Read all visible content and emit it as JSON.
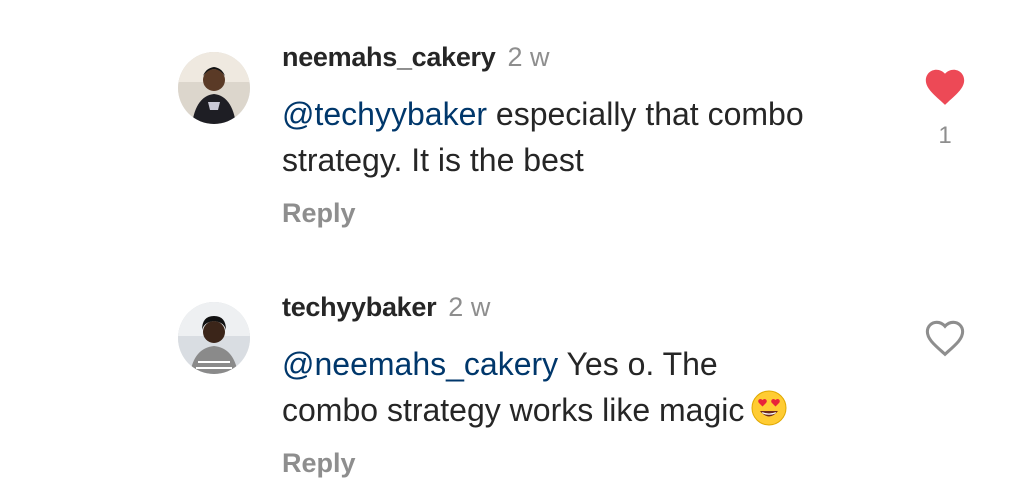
{
  "comments": [
    {
      "username": "neemahs_cakery",
      "time": "2 w",
      "mention": "@techyybaker",
      "text_line1": " especially that combo",
      "text_line2": "strategy. It is the best",
      "reply_label": "Reply",
      "liked": true,
      "like_count": "1"
    },
    {
      "username": "techyybaker",
      "time": "2 w",
      "mention": "@neemahs_cakery",
      "text_line1": " Yes o. The",
      "text_line2": "combo strategy works like magic",
      "emoji": "heart-eyes-emoji",
      "reply_label": "Reply",
      "liked": false,
      "like_count": ""
    }
  ],
  "colors": {
    "heart_filled": "#ed4956",
    "mention": "#00376b",
    "muted": "#8e8e8e",
    "text": "#262626"
  }
}
